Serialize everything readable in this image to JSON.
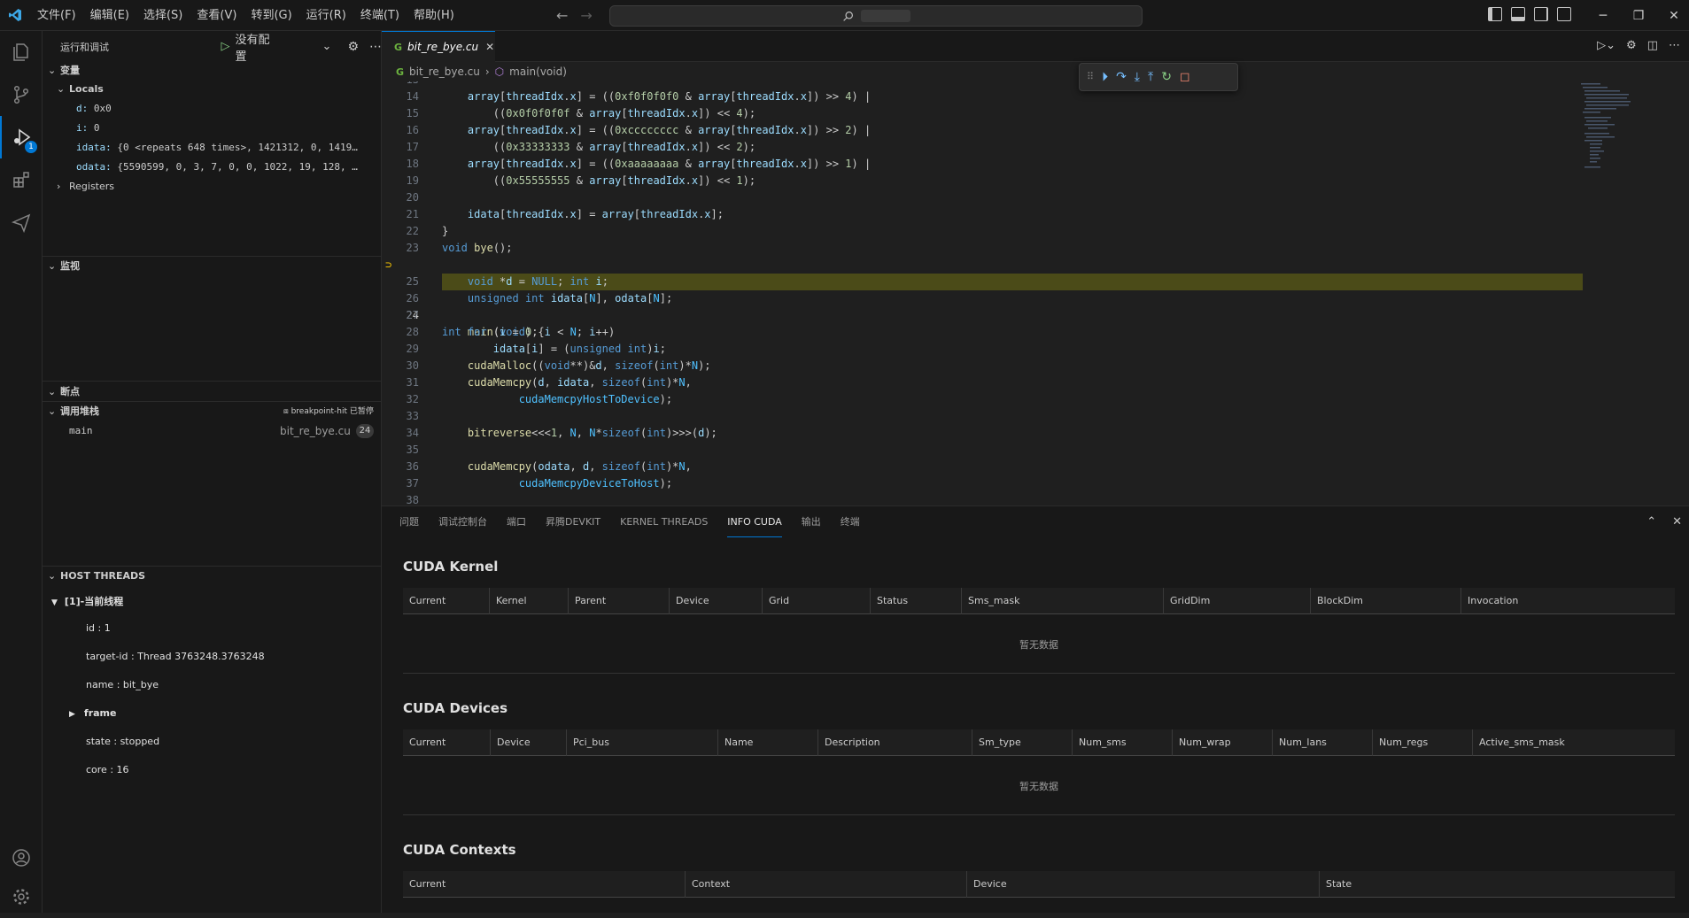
{
  "menu": [
    "文件(F)",
    "编辑(E)",
    "选择(S)",
    "查看(V)",
    "转到(G)",
    "运行(R)",
    "终端(T)",
    "帮助(H)"
  ],
  "sidebar": {
    "title": "运行和调试",
    "config": "没有配置",
    "sections": {
      "variables": "变量",
      "locals": "Locals",
      "registers": "Registers",
      "watch": "监视",
      "breakpoints": "断点",
      "callstack": "调用堆栈",
      "host_threads": "HOST THREADS"
    },
    "locals": [
      {
        "name": "d:",
        "value": "0x0"
      },
      {
        "name": "i:",
        "value": "0"
      },
      {
        "name": "idata:",
        "value": "{0 <repeats 648 times>, 1421312, 0, 1419…"
      },
      {
        "name": "odata:",
        "value": "{5590599, 0, 3, 7, 0, 0, 1022, 19, 128, …"
      }
    ],
    "callstack": {
      "status": "breakpoint-hit 已暂停",
      "frame": "main",
      "file": "bit_re_bye.cu",
      "line": "24"
    },
    "host_threads": {
      "thread": "[1]-当前线程",
      "id": "id : 1",
      "target_id": "target-id : Thread 3763248.3763248",
      "name": "name : bit_bye",
      "frame": "frame",
      "state": "state : stopped",
      "core": "core : 16"
    },
    "activity_badge": "1"
  },
  "editor": {
    "tab": "bit_re_bye.cu",
    "breadcrumb_file": "bit_re_bye.cu",
    "breadcrumb_symbol": "main(void)",
    "current_line": 24
  },
  "panel": {
    "tabs": [
      "问题",
      "调试控制台",
      "端口",
      "昇腾DEVKIT",
      "KERNEL THREADS",
      "INFO CUDA",
      "输出",
      "终端"
    ],
    "active_tab": "INFO CUDA",
    "kernel_title": "CUDA Kernel",
    "kernel_cols": [
      "Current",
      "Kernel",
      "Parent",
      "Device",
      "Grid",
      "Status",
      "Sms_mask",
      "GridDim",
      "BlockDim",
      "Invocation"
    ],
    "devices_title": "CUDA Devices",
    "devices_cols": [
      "Current",
      "Device",
      "Pci_bus",
      "Name",
      "Description",
      "Sm_type",
      "Num_sms",
      "Num_wrap",
      "Num_lans",
      "Num_regs",
      "Active_sms_mask"
    ],
    "contexts_title": "CUDA Contexts",
    "contexts_cols": [
      "Current",
      "Context",
      "Device",
      "State"
    ],
    "empty": "暂无数据"
  }
}
